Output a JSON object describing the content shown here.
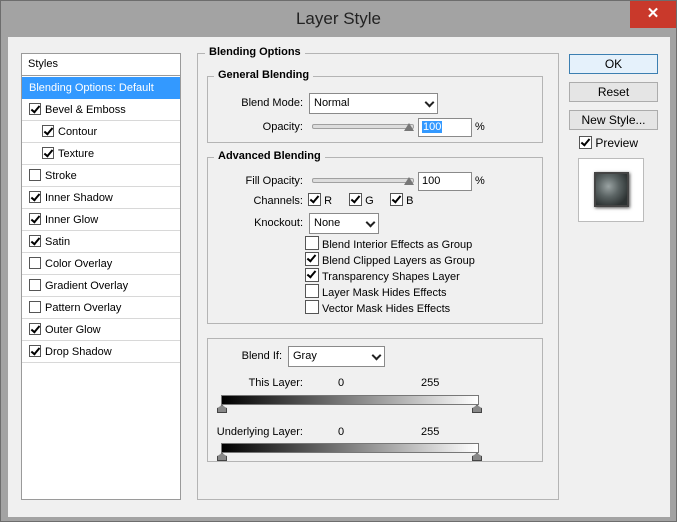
{
  "window": {
    "title": "Layer Style",
    "close_glyph": "✕"
  },
  "styles": {
    "header": "Styles",
    "items": [
      {
        "label": "Blending Options: Default",
        "checkbox": false,
        "checked": false,
        "selected": true,
        "sub": false
      },
      {
        "label": "Bevel & Emboss",
        "checkbox": true,
        "checked": true,
        "selected": false,
        "sub": false
      },
      {
        "label": "Contour",
        "checkbox": true,
        "checked": true,
        "selected": false,
        "sub": true
      },
      {
        "label": "Texture",
        "checkbox": true,
        "checked": true,
        "selected": false,
        "sub": true
      },
      {
        "label": "Stroke",
        "checkbox": true,
        "checked": false,
        "selected": false,
        "sub": false
      },
      {
        "label": "Inner Shadow",
        "checkbox": true,
        "checked": true,
        "selected": false,
        "sub": false
      },
      {
        "label": "Inner Glow",
        "checkbox": true,
        "checked": true,
        "selected": false,
        "sub": false
      },
      {
        "label": "Satin",
        "checkbox": true,
        "checked": true,
        "selected": false,
        "sub": false
      },
      {
        "label": "Color Overlay",
        "checkbox": true,
        "checked": false,
        "selected": false,
        "sub": false
      },
      {
        "label": "Gradient Overlay",
        "checkbox": true,
        "checked": false,
        "selected": false,
        "sub": false
      },
      {
        "label": "Pattern Overlay",
        "checkbox": true,
        "checked": false,
        "selected": false,
        "sub": false
      },
      {
        "label": "Outer Glow",
        "checkbox": true,
        "checked": true,
        "selected": false,
        "sub": false
      },
      {
        "label": "Drop Shadow",
        "checkbox": true,
        "checked": true,
        "selected": false,
        "sub": false
      }
    ]
  },
  "blending": {
    "section_title": "Blending Options",
    "general": {
      "title": "General Blending",
      "blend_mode_label": "Blend Mode:",
      "blend_mode_value": "Normal",
      "opacity_label": "Opacity:",
      "opacity_value": "100",
      "opacity_unit": "%"
    },
    "advanced": {
      "title": "Advanced Blending",
      "fill_opacity_label": "Fill Opacity:",
      "fill_opacity_value": "100",
      "fill_opacity_unit": "%",
      "channels_label": "Channels:",
      "channels": [
        {
          "label": "R",
          "checked": true
        },
        {
          "label": "G",
          "checked": true
        },
        {
          "label": "B",
          "checked": true
        }
      ],
      "knockout_label": "Knockout:",
      "knockout_value": "None",
      "options": [
        {
          "label": "Blend Interior Effects as Group",
          "checked": false
        },
        {
          "label": "Blend Clipped Layers as Group",
          "checked": true
        },
        {
          "label": "Transparency Shapes Layer",
          "checked": true
        },
        {
          "label": "Layer Mask Hides Effects",
          "checked": false
        },
        {
          "label": "Vector Mask Hides Effects",
          "checked": false
        }
      ]
    },
    "blend_if": {
      "label": "Blend If:",
      "value": "Gray",
      "this_layer_label": "This Layer:",
      "this_layer_min": "0",
      "this_layer_max": "255",
      "underlying_label": "Underlying Layer:",
      "underlying_min": "0",
      "underlying_max": "255"
    }
  },
  "buttons": {
    "ok": "OK",
    "reset": "Reset",
    "new_style": "New Style...",
    "preview_label": "Preview",
    "preview_checked": true
  }
}
